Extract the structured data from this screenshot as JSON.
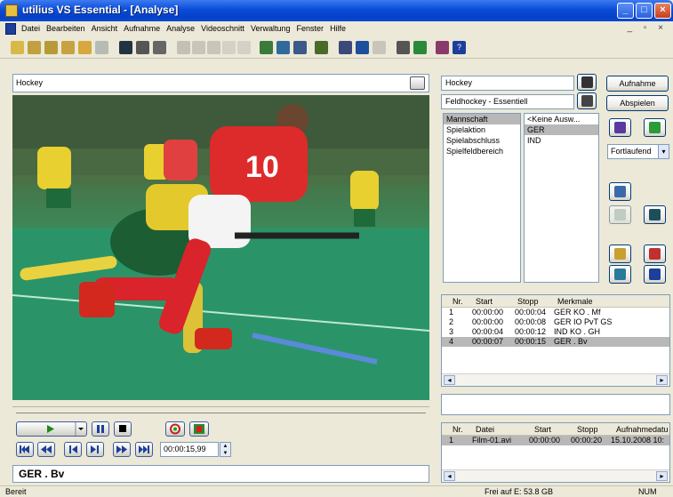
{
  "window": {
    "title": "utilius VS Essential - [Analyse]"
  },
  "menu": {
    "items": [
      "Datei",
      "Bearbeiten",
      "Ansicht",
      "Aufnahme",
      "Analyse",
      "Videoschnitt",
      "Verwaltung",
      "Fenster",
      "Hilfe"
    ],
    "mdi_controls": "_ ▫ ×"
  },
  "video": {
    "title": "Hockey",
    "player_number": "10",
    "timecode": "00:00:15,99",
    "current_marker": "GER . Bv"
  },
  "right_panel": {
    "category_name": "Hockey",
    "template_name": "Feldhockey - Essentiell",
    "record_button": "Aufnahme",
    "play_button": "Abspielen",
    "categories": [
      "Mannschaft",
      "Spielaktion",
      "Spielabschluss",
      "Spielfeldbereich"
    ],
    "selected_category": 0,
    "values": [
      "<Keine Ausw...",
      "GER",
      "IND"
    ],
    "selected_value": 1,
    "mode_select": "Fortlaufend"
  },
  "events_table": {
    "headers": [
      "Nr.",
      "Start",
      "Stopp",
      "Merkmale"
    ],
    "rows": [
      [
        "1",
        "00:00:00",
        "00:00:04",
        "GER KO . Mf"
      ],
      [
        "2",
        "00:00:00",
        "00:00:08",
        "GER IO PvT GS"
      ],
      [
        "3",
        "00:00:04",
        "00:00:12",
        "IND KO . GH"
      ],
      [
        "4",
        "00:00:07",
        "00:00:15",
        "GER . Bv"
      ]
    ],
    "selected_row": 3
  },
  "files_table": {
    "headers": [
      "Nr.",
      "Datei",
      "Start",
      "Stopp",
      "Aufnahmedatu"
    ],
    "rows": [
      [
        "1",
        "Film-01.avi",
        "00:00:00",
        "00:00:20",
        "15.10.2008 10:"
      ]
    ]
  },
  "statusbar": {
    "left": "Bereit",
    "disk": "Frei auf E: 53.8 GB",
    "num": "NUM"
  }
}
